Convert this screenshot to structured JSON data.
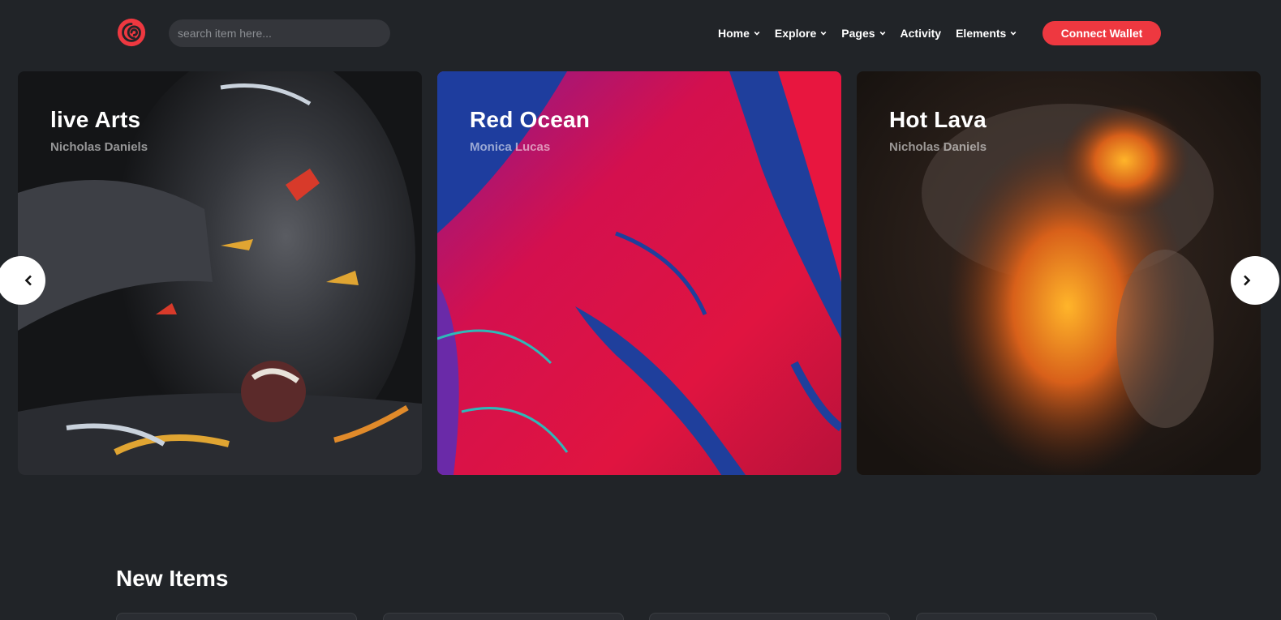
{
  "header": {
    "search_placeholder": "search item here...",
    "nav": [
      {
        "label": "Home",
        "has_dropdown": true
      },
      {
        "label": "Explore",
        "has_dropdown": true
      },
      {
        "label": "Pages",
        "has_dropdown": true
      },
      {
        "label": "Activity",
        "has_dropdown": false
      },
      {
        "label": "Elements",
        "has_dropdown": true
      }
    ],
    "connect_label": "Connect Wallet",
    "logo_icon": "spiral-logo-icon"
  },
  "carousel": {
    "items": [
      {
        "title": "live Arts",
        "author": "Nicholas Daniels"
      },
      {
        "title": "Red Ocean",
        "author": "Monica Lucas"
      },
      {
        "title": "Hot Lava",
        "author": "Nicholas Daniels"
      }
    ],
    "prev_icon": "chevron-left-icon",
    "next_icon": "chevron-right-icon"
  },
  "new_items": {
    "title": "New Items"
  },
  "colors": {
    "background": "#212428",
    "accent": "#ee3840",
    "search_bg": "#34363b"
  }
}
